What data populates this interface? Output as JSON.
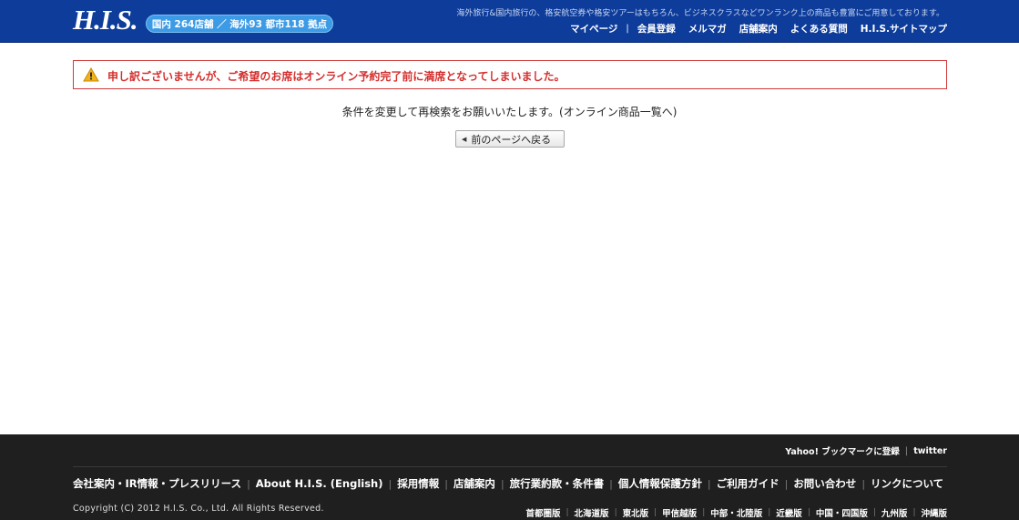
{
  "header": {
    "logo": "H.I.S.",
    "store_badge": "国内 264店舗 ／ 海外93 都市118 拠点",
    "tagline": "海外旅行&国内旅行の、格安航空券や格安ツアーはもちろん、ビジネスクラスなどワンランク上の商品も豊富にご用意しております。",
    "nav": [
      {
        "label": "マイページ"
      },
      {
        "label": "会員登録"
      },
      {
        "label": "メルマガ"
      },
      {
        "label": "店舗案内"
      },
      {
        "label": "よくある質問"
      },
      {
        "label": "H.I.S.サイトマップ"
      }
    ],
    "nav_sep": "|"
  },
  "error": {
    "icon": "warning-icon",
    "text": "申し訳ございませんが、ご希望のお席はオンライン予約完了前に満席となってしまいました。"
  },
  "message": "条件を変更して再検索をお願いいたします。(オンライン商品一覧へ)",
  "back_button": {
    "arrow": "◀",
    "label": "前のページへ戻る"
  },
  "footer": {
    "top_links": [
      {
        "label": "Yahoo! ブックマークに登録"
      },
      {
        "label": "twitter"
      }
    ],
    "links": [
      {
        "label": "会社案内・IR情報・プレスリリース"
      },
      {
        "label": "About H.I.S. (English)"
      },
      {
        "label": "採用情報"
      },
      {
        "label": "店舗案内"
      },
      {
        "label": "旅行業約款・条件書"
      },
      {
        "label": "個人情報保護方針"
      },
      {
        "label": "ご利用ガイド"
      },
      {
        "label": "お問い合わせ"
      },
      {
        "label": "リンクについて"
      }
    ],
    "copyright": "Copyright (C) 2012 H.I.S. Co., Ltd. All Rights Reserved.",
    "regions": [
      {
        "label": "首都圏版"
      },
      {
        "label": "北海道版"
      },
      {
        "label": "東北版"
      },
      {
        "label": "甲信越版"
      },
      {
        "label": "中部・北陸版"
      },
      {
        "label": "近畿版"
      },
      {
        "label": "中国・四国版"
      },
      {
        "label": "九州版"
      },
      {
        "label": "沖縄版"
      }
    ]
  },
  "colors": {
    "header_bg": "#0d3c9a",
    "badge_bg": "#3d9be6",
    "error_red": "#d3302e",
    "footer_bg": "#1f1f1f"
  }
}
